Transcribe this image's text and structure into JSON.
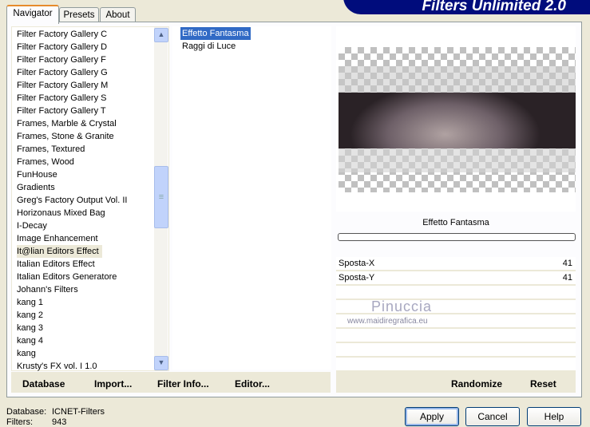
{
  "app": {
    "title": "Filters Unlimited 2.0"
  },
  "tabs": [
    "Navigator",
    "Presets",
    "About"
  ],
  "categories": [
    "Filter Factory Gallery C",
    "Filter Factory Gallery D",
    "Filter Factory Gallery F",
    "Filter Factory Gallery G",
    "Filter Factory Gallery M",
    "Filter Factory Gallery S",
    "Filter Factory Gallery T",
    "Frames, Marble & Crystal",
    "Frames, Stone & Granite",
    "Frames, Textured",
    "Frames, Wood",
    "FunHouse",
    "Gradients",
    "Greg's Factory Output Vol. II",
    "Horizonaus Mixed Bag",
    "I-Decay",
    "Image Enhancement",
    "It@lian Editors Effect",
    "Italian Editors Effect",
    "Italian Editors Generatore",
    "Johann's Filters",
    "kang 1",
    "kang 2",
    "kang 3",
    "kang 4",
    "kang",
    "Krusty's FX vol. I 1.0"
  ],
  "selected_category": "It@lian Editors Effect",
  "filters": [
    "Effetto Fantasma",
    "Raggi di Luce"
  ],
  "selected_filter": "Effetto Fantasma",
  "preview_title": "Effetto Fantasma",
  "params": [
    {
      "label": "Sposta-X",
      "value": "41"
    },
    {
      "label": "Sposta-Y",
      "value": "41"
    }
  ],
  "watermark": {
    "name": "Pinuccia",
    "url": "www.maidiregrafica.eu"
  },
  "left_buttons": [
    "Database",
    "Import...",
    "Filter Info...",
    "Editor..."
  ],
  "right_buttons": {
    "randomize": "Randomize",
    "reset": "Reset"
  },
  "status": {
    "database_label": "Database:",
    "database_value": "ICNET-Filters",
    "filters_label": "Filters:",
    "filters_value": "943"
  },
  "dialog_buttons": {
    "apply": "Apply",
    "cancel": "Cancel",
    "help": "Help"
  }
}
